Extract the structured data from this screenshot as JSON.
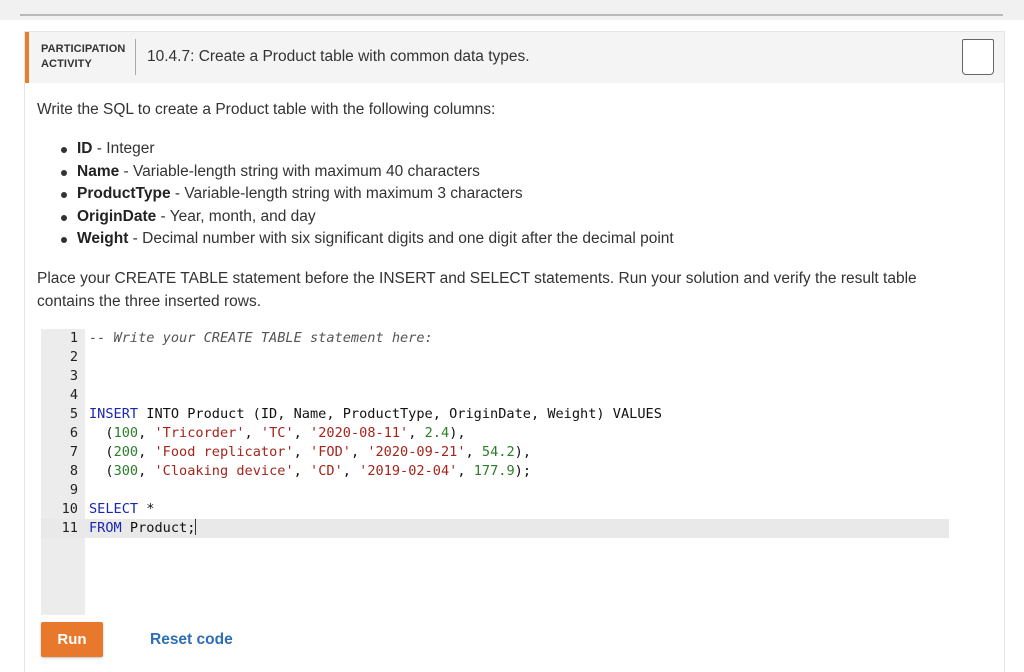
{
  "activity": {
    "label": "PARTICIPATION ACTIVITY",
    "title": "10.4.7: Create a Product table with common data types.",
    "completion_icon": "square-outline-icon"
  },
  "instructions": {
    "intro": "Write the SQL to create a Product table with the following columns:",
    "columns": [
      {
        "name": "ID",
        "desc": " - Integer"
      },
      {
        "name": "Name",
        "desc": " - Variable-length string with maximum 40 characters"
      },
      {
        "name": "ProductType",
        "desc": " - Variable-length string with maximum 3 characters"
      },
      {
        "name": "OriginDate",
        "desc": " - Year, month, and day"
      },
      {
        "name": "Weight",
        "desc": " - Decimal number with six significant digits and one digit after the decimal point"
      }
    ],
    "place": "Place your CREATE TABLE statement before the INSERT and SELECT statements. Run your solution and verify the result table contains the three inserted rows."
  },
  "editor": {
    "line_numbers": [
      "1",
      "2",
      "3",
      "4",
      "5",
      "6",
      "7",
      "8",
      "9",
      "10",
      "11"
    ],
    "lines": [
      [
        {
          "t": "-- Write your CREATE TABLE statement here:",
          "c": "comment"
        }
      ],
      [],
      [],
      [],
      [
        {
          "t": "INSERT",
          "c": "kw"
        },
        {
          "t": " INTO Product (ID, Name, ProductType, OriginDate, Weight) VALUES",
          "c": ""
        }
      ],
      [
        {
          "t": "  (",
          "c": ""
        },
        {
          "t": "100",
          "c": "num"
        },
        {
          "t": ", ",
          "c": ""
        },
        {
          "t": "'Tricorder'",
          "c": "str"
        },
        {
          "t": ", ",
          "c": ""
        },
        {
          "t": "'TC'",
          "c": "str"
        },
        {
          "t": ", ",
          "c": ""
        },
        {
          "t": "'2020-08-11'",
          "c": "str"
        },
        {
          "t": ", ",
          "c": ""
        },
        {
          "t": "2.4",
          "c": "num"
        },
        {
          "t": "),",
          "c": ""
        }
      ],
      [
        {
          "t": "  (",
          "c": ""
        },
        {
          "t": "200",
          "c": "num"
        },
        {
          "t": ", ",
          "c": ""
        },
        {
          "t": "'Food replicator'",
          "c": "str"
        },
        {
          "t": ", ",
          "c": ""
        },
        {
          "t": "'FOD'",
          "c": "str"
        },
        {
          "t": ", ",
          "c": ""
        },
        {
          "t": "'2020-09-21'",
          "c": "str"
        },
        {
          "t": ", ",
          "c": ""
        },
        {
          "t": "54.2",
          "c": "num"
        },
        {
          "t": "),",
          "c": ""
        }
      ],
      [
        {
          "t": "  (",
          "c": ""
        },
        {
          "t": "300",
          "c": "num"
        },
        {
          "t": ", ",
          "c": ""
        },
        {
          "t": "'Cloaking device'",
          "c": "str"
        },
        {
          "t": ", ",
          "c": ""
        },
        {
          "t": "'CD'",
          "c": "str"
        },
        {
          "t": ", ",
          "c": ""
        },
        {
          "t": "'2019-02-04'",
          "c": "str"
        },
        {
          "t": ", ",
          "c": ""
        },
        {
          "t": "177.9",
          "c": "num"
        },
        {
          "t": ");",
          "c": ""
        }
      ],
      [],
      [
        {
          "t": "SELECT",
          "c": "kw"
        },
        {
          "t": " *",
          "c": ""
        }
      ],
      [
        {
          "t": "FROM",
          "c": "kw"
        },
        {
          "t": " Product;",
          "c": ""
        }
      ]
    ],
    "active_line": 11
  },
  "buttons": {
    "run_label": "Run",
    "reset_label": "Reset code"
  },
  "colors": {
    "accent": "#e8782b",
    "link": "#2f6db5",
    "keyword": "#1a25b5",
    "string": "#a6241b",
    "number": "#2b7d2b"
  }
}
